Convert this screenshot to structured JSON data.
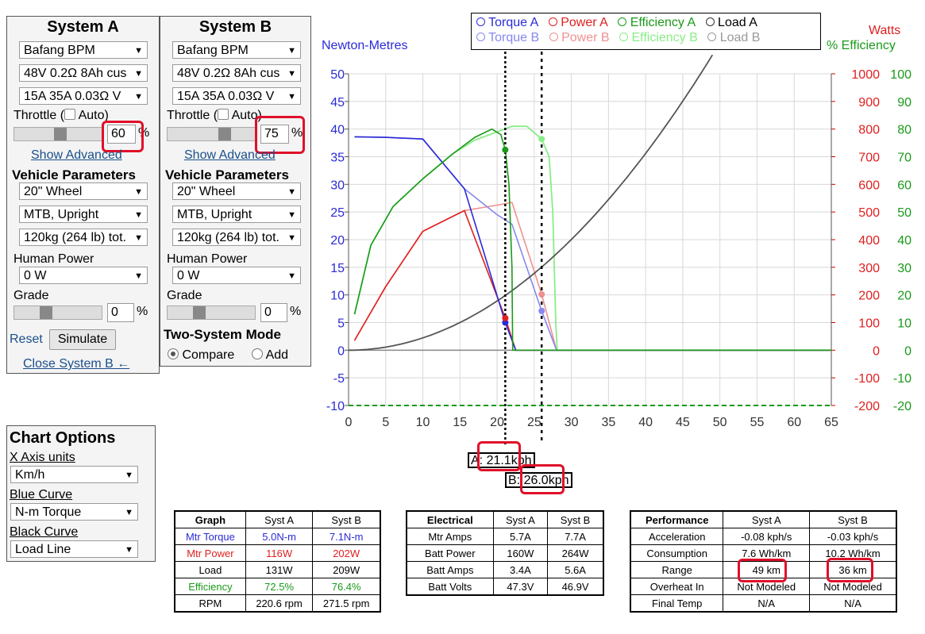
{
  "systemA": {
    "title": "System A",
    "motor": "Bafang BPM",
    "battery": "48V 0.2Ω 8Ah cus",
    "controller": "15A 35A 0.03Ω V",
    "throttle_label": "Throttle (",
    "auto_label": "Auto)",
    "throttle_value": "60",
    "throttle_level": 0.6,
    "pct": "%",
    "show_advanced": "Show Advanced",
    "vehicle_heading": "Vehicle Parameters",
    "wheel": "20\"  Wheel",
    "bike_type": "MTB, Upright",
    "weight": "120kg (264 lb) tot.",
    "human_power_label": "Human Power",
    "human_power": "0 W",
    "grade_label": "Grade",
    "grade_value": "0",
    "reset": "Reset",
    "simulate": "Simulate",
    "close_b": "Close System B ←"
  },
  "systemB": {
    "title": "System B",
    "motor": "Bafang BPM",
    "battery": "48V 0.2Ω 8Ah cus",
    "controller": "15A 35A 0.03Ω V",
    "throttle_label": "Throttle (",
    "auto_label": "Auto)",
    "throttle_value": "75",
    "throttle_level": 0.75,
    "pct": "%",
    "show_advanced": "Show Advanced",
    "vehicle_heading": "Vehicle Parameters",
    "wheel": "20\"  Wheel",
    "bike_type": "MTB, Upright",
    "weight": "120kg (264 lb) tot.",
    "human_power_label": "Human Power",
    "human_power": "0 W",
    "grade_label": "Grade",
    "grade_value": "0",
    "two_system_heading": "Two-System Mode",
    "compare": "Compare",
    "add": "Add"
  },
  "chart_options": {
    "title": "Chart Options",
    "x_units_label": "X Axis units",
    "x_units": "Km/h",
    "blue_label": "Blue Curve",
    "blue": "N-m Torque",
    "black_label": "Black Curve",
    "black": "Load Line"
  },
  "legend": {
    "row1": [
      "Torque A",
      "Power A",
      "Efficiency A",
      "Load A"
    ],
    "row2": [
      "Torque B",
      "Power B",
      "Efficiency B",
      "Load B"
    ]
  },
  "markers": {
    "a_prefix": "A: ",
    "a_value": "21.1",
    "a_unit": "kph",
    "b_prefix": "B: ",
    "b_value": "26.0",
    "b_unit": "kph"
  },
  "colors": {
    "torqueA": "#2b2bd6",
    "torqueB": "#8888ee",
    "powerA": "#e02020",
    "powerB": "#f09090",
    "effA": "#1a9a1a",
    "effB": "#88ee88",
    "loadA": "#555555",
    "loadB": "#999999",
    "highlight": "#e0102a"
  },
  "chart_data": {
    "type": "line",
    "ylabel_left": "Newton-Metres",
    "ylabel_right_power": "Watts",
    "ylabel_right_eff": "% Efficiency",
    "xlim": [
      0,
      65
    ],
    "ylim": [
      -10,
      50
    ],
    "power_lim": [
      -200,
      1000
    ],
    "eff_lim": [
      -20,
      100
    ],
    "x_ticks": [
      0,
      5,
      10,
      15,
      20,
      25,
      30,
      35,
      40,
      45,
      50,
      55,
      60,
      65
    ],
    "y_ticks": [
      -10,
      -5,
      0,
      5,
      10,
      15,
      20,
      25,
      30,
      35,
      40,
      45,
      50
    ],
    "power_ticks": [
      -200,
      -100,
      0,
      100,
      200,
      300,
      400,
      500,
      600,
      700,
      800,
      900,
      1000
    ],
    "eff_ticks": [
      -20,
      -10,
      0,
      10,
      20,
      30,
      40,
      50,
      60,
      70,
      80,
      90,
      100
    ],
    "grid": true,
    "markers_x": [
      21.1,
      26.0
    ],
    "series": [
      {
        "name": "Torque A",
        "axis": "nm",
        "points": [
          [
            0.8,
            38.6
          ],
          [
            5,
            38.5
          ],
          [
            10,
            38.2
          ],
          [
            15.6,
            29.2
          ],
          [
            21.1,
            5.0
          ],
          [
            22.5,
            0
          ],
          [
            65,
            0
          ]
        ]
      },
      {
        "name": "Torque B",
        "axis": "nm",
        "points": [
          [
            0.8,
            38.6
          ],
          [
            5,
            38.5
          ],
          [
            10,
            38.2
          ],
          [
            15.6,
            29.2
          ],
          [
            20,
            24.5
          ],
          [
            22,
            22.8
          ],
          [
            26,
            7.1
          ],
          [
            28,
            0
          ],
          [
            65,
            0
          ]
        ]
      },
      {
        "name": "Power A",
        "axis": "w",
        "points": [
          [
            0.8,
            35
          ],
          [
            5,
            230
          ],
          [
            10,
            430
          ],
          [
            15.6,
            505
          ],
          [
            21.1,
            116
          ],
          [
            22.5,
            0
          ],
          [
            65,
            0
          ]
        ]
      },
      {
        "name": "Power B",
        "axis": "w",
        "points": [
          [
            0.8,
            35
          ],
          [
            5,
            230
          ],
          [
            10,
            430
          ],
          [
            15.6,
            505
          ],
          [
            20,
            525
          ],
          [
            22,
            535
          ],
          [
            26,
            202
          ],
          [
            28,
            0
          ],
          [
            65,
            0
          ]
        ]
      },
      {
        "name": "Efficiency A",
        "axis": "eff",
        "points": [
          [
            0.8,
            13
          ],
          [
            3,
            38
          ],
          [
            6,
            52
          ],
          [
            10,
            62
          ],
          [
            14,
            71
          ],
          [
            17,
            77
          ],
          [
            19.3,
            80
          ],
          [
            20.5,
            78
          ],
          [
            21.1,
            72.5
          ],
          [
            21.6,
            60
          ],
          [
            22,
            30
          ],
          [
            22.1,
            0
          ],
          [
            65,
            0
          ]
        ]
      },
      {
        "name": "Efficiency B",
        "axis": "eff",
        "points": [
          [
            0.8,
            13
          ],
          [
            3,
            38
          ],
          [
            6,
            52
          ],
          [
            10,
            62
          ],
          [
            14,
            71
          ],
          [
            17,
            76
          ],
          [
            20,
            79
          ],
          [
            22,
            81
          ],
          [
            24,
            81
          ],
          [
            26,
            76.4
          ],
          [
            27,
            70
          ],
          [
            27.5,
            50
          ],
          [
            27.9,
            10
          ],
          [
            28.1,
            0
          ],
          [
            65,
            0
          ]
        ]
      },
      {
        "name": "Load A",
        "axis": "w",
        "points": [
          [
            0,
            0
          ],
          [
            10,
            40
          ],
          [
            21.1,
            131
          ],
          [
            26,
            209
          ],
          [
            30,
            290
          ],
          [
            35,
            420
          ],
          [
            40,
            600
          ],
          [
            45,
            830
          ],
          [
            49,
            1070
          ]
        ]
      }
    ]
  },
  "table_graph": {
    "headers": [
      "Graph",
      "Syst A",
      "Syst B"
    ],
    "rows": [
      {
        "label": "Mtr Torque",
        "a": "5.0N-m",
        "b": "7.1N-m",
        "color": "#2b2bd6"
      },
      {
        "label": "Mtr Power",
        "a": "116W",
        "b": "202W",
        "color": "#e02020"
      },
      {
        "label": "Load",
        "a": "131W",
        "b": "209W",
        "color": "#000000"
      },
      {
        "label": "Efficiency",
        "a": "72.5%",
        "b": "76.4%",
        "color": "#1a9a1a"
      },
      {
        "label": "RPM",
        "a": "220.6 rpm",
        "b": "271.5 rpm",
        "color": "#000000"
      }
    ]
  },
  "table_electrical": {
    "headers": [
      "Electrical",
      "Syst A",
      "Syst B"
    ],
    "rows": [
      {
        "label": "Mtr Amps",
        "a": "5.7A",
        "b": "7.7A"
      },
      {
        "label": "Batt Power",
        "a": "160W",
        "b": "264W"
      },
      {
        "label": "Batt Amps",
        "a": "3.4A",
        "b": "5.6A"
      },
      {
        "label": "Batt Volts",
        "a": "47.3V",
        "b": "46.9V"
      }
    ]
  },
  "table_performance": {
    "headers": [
      "Performance",
      "Syst A",
      "Syst B"
    ],
    "rows": [
      {
        "label": "Acceleration",
        "a": "-0.08 kph/s",
        "b": "-0.03 kph/s"
      },
      {
        "label": "Consumption",
        "a": "7.6 Wh/km",
        "b": "10.2 Wh/km"
      },
      {
        "label": "Range",
        "a": "49 km",
        "b": "36 km"
      },
      {
        "label": "Overheat In",
        "a": "Not Modeled",
        "b": "Not Modeled"
      },
      {
        "label": "Final Temp",
        "a": "N/A",
        "b": "N/A"
      }
    ]
  }
}
